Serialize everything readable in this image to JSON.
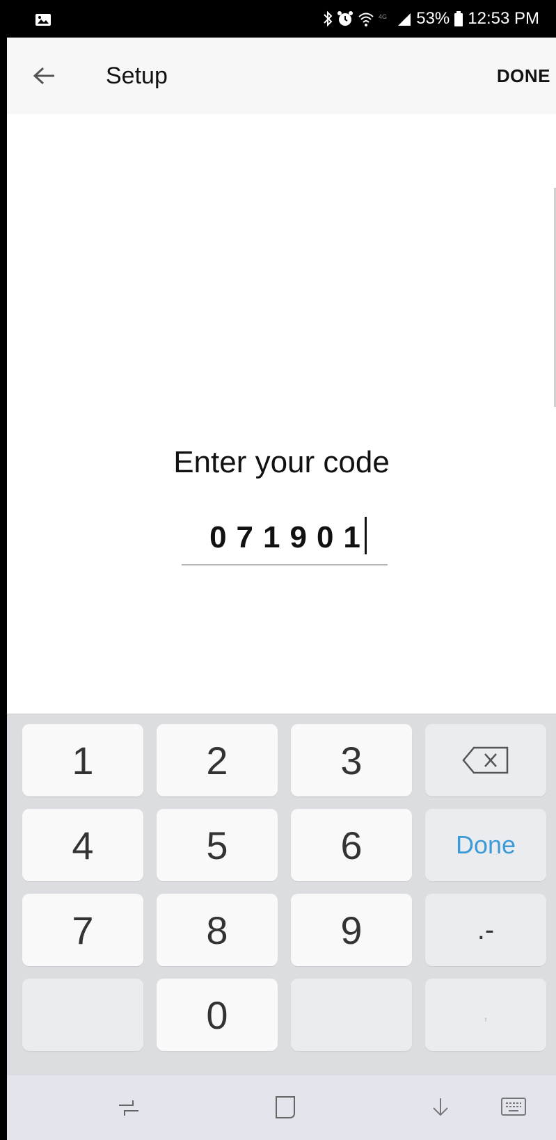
{
  "status_bar": {
    "battery": "53%",
    "time": "12:53 PM",
    "icons": [
      "gallery-icon",
      "bluetooth-icon",
      "alarm-icon",
      "wifi-icon",
      "lte-icon",
      "signal-icon",
      "battery-icon"
    ]
  },
  "app_bar": {
    "title": "Setup",
    "done_label": "DONE",
    "back_icon": "arrow-left-icon"
  },
  "content": {
    "prompt": "Enter your code",
    "code_value": "071901"
  },
  "keyboard": {
    "keys": {
      "k1": "1",
      "k2": "2",
      "k3": "3",
      "k4": "4",
      "k5": "5",
      "k6": "6",
      "k7": "7",
      "k8": "8",
      "k9": "9",
      "k0": "0",
      "done": "Done",
      "symbols": ".-",
      "comma": ","
    },
    "backspace_icon": "backspace-icon",
    "done_color": "#3c9ad6"
  },
  "nav_bar": {
    "icons": [
      "recent-apps-icon",
      "home-icon",
      "hide-keyboard-icon",
      "keyboard-switch-icon"
    ]
  }
}
